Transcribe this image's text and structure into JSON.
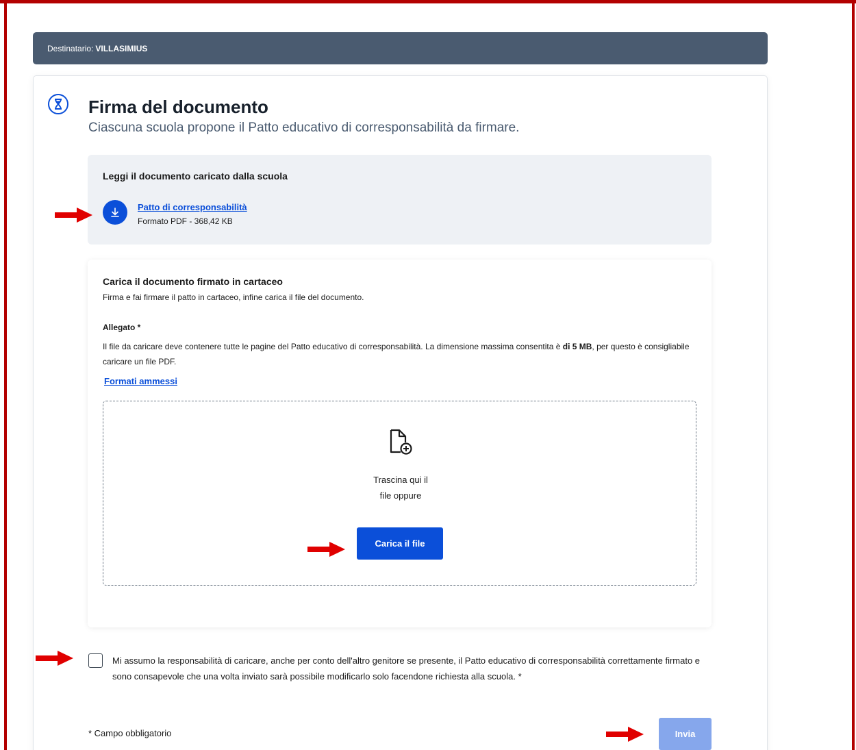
{
  "recipient": {
    "label": "Destinatario:",
    "value": "VILLASIMIUS"
  },
  "header": {
    "title": "Firma del documento",
    "subtitle": "Ciascuna scuola propone il Patto educativo di corresponsabilità da firmare."
  },
  "read_section": {
    "title": "Leggi il documento caricato dalla scuola",
    "doc_link": "Patto di corresponsabilità",
    "doc_meta": "Formato PDF - 368,42 KB"
  },
  "upload_section": {
    "title": "Carica il documento firmato in cartaceo",
    "description": "Firma e fai firmare il patto in cartaceo, infine carica il file del documento.",
    "attachment_label": "Allegato *",
    "attachment_desc_1": "Il file da caricare deve contenere tutte le pagine del Patto educativo di corresponsabilità. La dimensione massima consentita è ",
    "attachment_desc_bold": "di 5 MB",
    "attachment_desc_2": ", per questo è consigliabile caricare un file PDF.",
    "formats_link": "Formati ammessi",
    "drag_line_1": "Trascina qui il",
    "drag_line_2": "file oppure",
    "upload_button": "Carica il file"
  },
  "consent": {
    "checked": false,
    "text": "Mi assumo la responsabilità di caricare, anche per conto dell'altro genitore se presente, il Patto educativo di corresponsabilità correttamente firmato e sono consapevole che una volta inviato sarà possibile modificarlo solo facendone richiesta alla scuola. *"
  },
  "footer": {
    "required_note": "* Campo obbligatorio",
    "send_button": "Invia"
  },
  "colors": {
    "primary": "#0b4fd9",
    "disabled_primary": "#86a7ec",
    "header_bar": "#4a5b70",
    "annotation_red": "#e00000"
  },
  "icons": [
    "hourglass-icon",
    "download-icon",
    "file-add-icon",
    "arrow-annotation-icon"
  ]
}
